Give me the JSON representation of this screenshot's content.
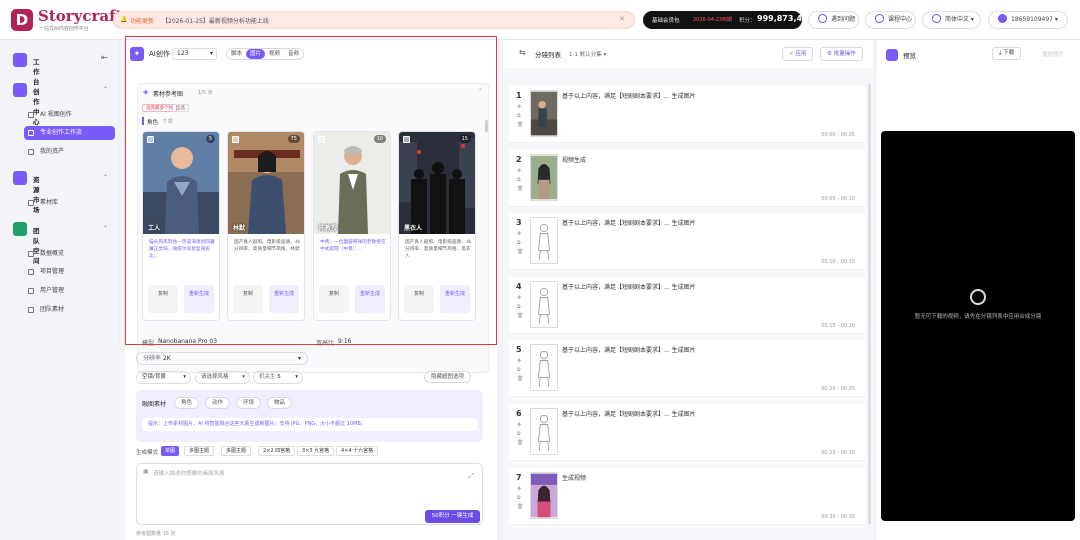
{
  "brand": {
    "name": "Storycraft",
    "subtitle": "一站式AI内容创作平台"
  },
  "notice": {
    "tag": "功能更新",
    "text": "【2026-01-25】最新视频分析功能上线"
  },
  "plan": {
    "name": "基础会员包",
    "expiry": "2026-04-23到期",
    "points_label": "积分：",
    "points": "999,873,443"
  },
  "top_buttons": {
    "help": "遇到问题",
    "course": "课程中心",
    "lang": "简体中文",
    "user": "18659109497"
  },
  "sidebar": {
    "workbench": "工作台",
    "creation": "创作中心",
    "ai_creation": "AI 视图创作",
    "pro_flow": "专业创作工作流",
    "my_assets": "我的资产",
    "market": "资源市场",
    "material_lib": "素材库",
    "team": "团队空间",
    "data_overview": "数据概览",
    "project_mgmt": "项目管理",
    "user_mgmt": "用户管理",
    "team_material": "团队素材"
  },
  "creator": {
    "title": "AI创作",
    "project": "123",
    "tabs": [
      "脚本",
      "图片",
      "视频",
      "音频"
    ],
    "active_tab": "图片",
    "ref_title": "素材参考图",
    "ref_count": "1/5 张",
    "chips": [
      "选完最多个片",
      "全选"
    ],
    "role_label": "角色",
    "role_count": "7 项",
    "cards": [
      {
        "name": "工人",
        "count": "5",
        "desc": "描头风风刻估一页波海源鼠四翼翼正灵缺、微愿尔双星型海说北…",
        "tag": "真实系",
        "btn1": "复制",
        "btn2": "重新生成"
      },
      {
        "name": "林默",
        "count": "75",
        "desc": "国产真人剧照、电影级画质、4k分辨率、高质量细节风格、林默",
        "tag": "古装风格",
        "btn1": "复制",
        "btn2": "重新生成"
      },
      {
        "name": "陈教授",
        "count": "10",
        "desc": "中青、一位面容慈祥的老教授在中式庭院（中景）…",
        "tag": "学者",
        "btn1": "复制",
        "btn2": "重新生成"
      },
      {
        "name": "黑衣人",
        "count": "15",
        "desc": "国产真人剧照、电影级画质、4k分辨率、高质量细节风格、黑衣人",
        "tag": "团体戏",
        "btn1": "复制",
        "btn2": "重新生成"
      }
    ],
    "model_label": "模型",
    "model": "Nanobanana Pro 03",
    "ratio_label": "宽高比",
    "ratio": "9:16",
    "res_label": "分辨率",
    "resolution": "2K",
    "scene": "空镜/背景",
    "style": "请选择风格",
    "pose_label": "机关生",
    "pose": "5",
    "hide_options": "隐藏超图选项",
    "fusion_label": "融图素材",
    "fusion_tags": [
      "角色",
      "动作",
      "环境",
      "物品"
    ],
    "tip": "提示：上传素材图片，AI 将智能融合这些元素生成新图片。支持 JPG、PNG，大小不超过 10MB。",
    "mode_label": "生成模式",
    "modes": [
      "单图",
      "多图主题",
      "多图主题",
      "2×2 四宫格",
      "3×3 九宫格",
      "4×4 十六宫格"
    ],
    "active_mode": "单图",
    "prompt_placeholder": "请输入描述你想要的画面风格",
    "submit": "50积分 一键生成",
    "ref_note": "参考图数量 16 张"
  },
  "storyboard": {
    "title": "分镜列表",
    "count": "1-1 默认分集",
    "apply": "应用",
    "batch": "批量操作",
    "rows": [
      {
        "num": "1",
        "text": "基于以上内容，满足【短剧剧本要求】... 生成图片",
        "time": "00:00 - 00:05"
      },
      {
        "num": "2",
        "text": "视频生成",
        "time": "00:05 - 00:10"
      },
      {
        "num": "3",
        "text": "基于以上内容，满足【短剧剧本要求】... 生成图片",
        "time": "00:10 - 00:15"
      },
      {
        "num": "4",
        "text": "基于以上内容，满足【短剧剧本要求】... 生成图片",
        "time": "00:15 - 00:20"
      },
      {
        "num": "5",
        "text": "基于以上内容，满足【短剧剧本要求】... 生成图片",
        "time": "00:20 - 00:25"
      },
      {
        "num": "6",
        "text": "基于以上内容，满足【短剧剧本要求】... 生成图片",
        "time": "00:25 - 00:30"
      },
      {
        "num": "7",
        "text": "生成视频",
        "time": "00:30 - 00:35"
      }
    ]
  },
  "preview": {
    "title": "预览",
    "download": "下载",
    "extra": "播放器件",
    "empty": "暂无可下载的视频，请先在分镜列表中应用合成分镜"
  }
}
